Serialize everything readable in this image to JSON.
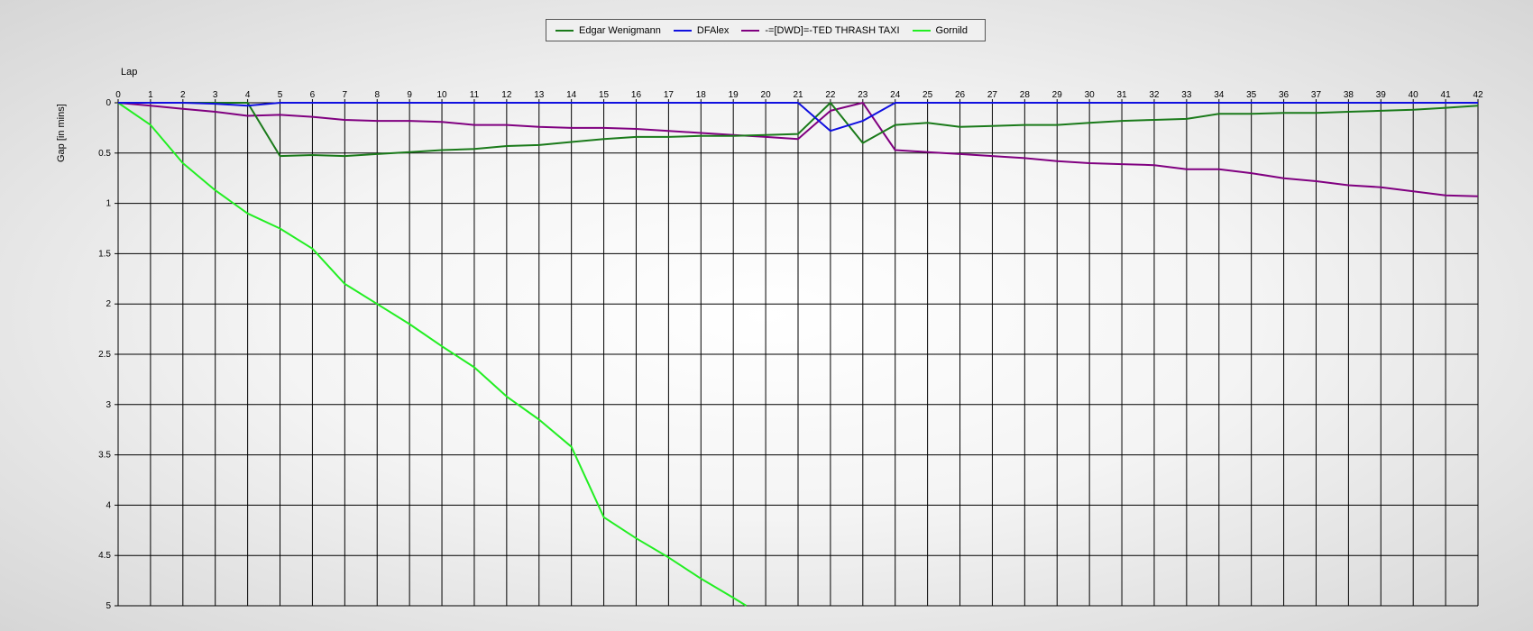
{
  "legend": [
    {
      "name": "Edgar Wenigmann",
      "color": "#1a7a1a"
    },
    {
      "name": "DFAlex",
      "color": "#1010e0"
    },
    {
      "name": "-=[DWD]=-TED THRASH TAXI",
      "color": "#800080"
    },
    {
      "name": "Gornild",
      "color": "#22ee22"
    }
  ],
  "chart_data": {
    "type": "line",
    "title": "",
    "xlabel": "Lap",
    "ylabel": "Gap [in mins]",
    "xlim": [
      0,
      42
    ],
    "ylim": [
      0,
      5
    ],
    "y_inverted": true,
    "grid": true,
    "legend_position": "top-center",
    "x_ticks": [
      0,
      1,
      2,
      3,
      4,
      5,
      6,
      7,
      8,
      9,
      10,
      11,
      12,
      13,
      14,
      15,
      16,
      17,
      18,
      19,
      20,
      21,
      22,
      23,
      24,
      25,
      26,
      27,
      28,
      29,
      30,
      31,
      32,
      33,
      34,
      35,
      36,
      37,
      38,
      39,
      40,
      41,
      42
    ],
    "y_ticks": [
      "0",
      "0.5",
      "1",
      "1.5",
      "2",
      "2.5",
      "3",
      "3.5",
      "4",
      "4.5",
      "5"
    ],
    "series": [
      {
        "name": "Edgar Wenigmann",
        "color": "#1a7a1a",
        "x": [
          0,
          1,
          2,
          3,
          4,
          5,
          6,
          7,
          8,
          9,
          10,
          11,
          12,
          13,
          14,
          15,
          16,
          17,
          18,
          19,
          20,
          21,
          22,
          23,
          24,
          25,
          26,
          27,
          28,
          29,
          30,
          31,
          32,
          33,
          34,
          35,
          36,
          37,
          38,
          39,
          40,
          41,
          42
        ],
        "y": [
          0,
          0,
          0,
          0,
          0,
          0.53,
          0.52,
          0.53,
          0.51,
          0.49,
          0.47,
          0.46,
          0.43,
          0.42,
          0.39,
          0.36,
          0.34,
          0.34,
          0.33,
          0.33,
          0.32,
          0.31,
          0,
          0.4,
          0.22,
          0.2,
          0.24,
          0.23,
          0.22,
          0.22,
          0.2,
          0.18,
          0.17,
          0.16,
          0.11,
          0.11,
          0.1,
          0.1,
          0.09,
          0.08,
          0.07,
          0.05,
          0.03
        ]
      },
      {
        "name": "DFAlex",
        "color": "#1010e0",
        "x": [
          0,
          1,
          2,
          3,
          4,
          5,
          6,
          7,
          8,
          9,
          10,
          11,
          12,
          13,
          14,
          15,
          16,
          17,
          18,
          19,
          20,
          21,
          22,
          23,
          24,
          25,
          26,
          27,
          28,
          29,
          30,
          31,
          32,
          33,
          34,
          35,
          36,
          37,
          38,
          39,
          40,
          41,
          42
        ],
        "y": [
          0,
          0,
          0,
          0.01,
          0.03,
          0,
          0,
          0,
          0,
          0,
          0,
          0,
          0,
          0,
          0,
          0,
          0,
          0,
          0,
          0,
          0,
          0,
          0.28,
          0.18,
          0,
          0,
          0,
          0,
          0,
          0,
          0,
          0,
          0,
          0,
          0,
          0,
          0,
          0,
          0,
          0,
          0,
          0,
          0
        ]
      },
      {
        "name": "-=[DWD]=-TED THRASH TAXI",
        "color": "#800080",
        "x": [
          0,
          1,
          2,
          3,
          4,
          5,
          6,
          7,
          8,
          9,
          10,
          11,
          12,
          13,
          14,
          15,
          16,
          17,
          18,
          19,
          20,
          21,
          22,
          23,
          24,
          25,
          26,
          27,
          28,
          29,
          30,
          31,
          32,
          33,
          34,
          35,
          36,
          37,
          38,
          39,
          40,
          41,
          42
        ],
        "y": [
          0,
          0.03,
          0.06,
          0.09,
          0.13,
          0.12,
          0.14,
          0.17,
          0.18,
          0.18,
          0.19,
          0.22,
          0.22,
          0.24,
          0.25,
          0.25,
          0.26,
          0.28,
          0.3,
          0.32,
          0.34,
          0.36,
          0.08,
          0,
          0.47,
          0.49,
          0.51,
          0.53,
          0.55,
          0.58,
          0.6,
          0.61,
          0.62,
          0.66,
          0.66,
          0.7,
          0.75,
          0.78,
          0.82,
          0.84,
          0.88,
          0.92,
          0.93
        ]
      },
      {
        "name": "Gornild",
        "color": "#22ee22",
        "x": [
          0,
          1,
          2,
          3,
          4,
          5,
          6,
          7,
          8,
          9,
          10,
          11,
          12,
          13,
          14,
          15,
          16,
          17,
          18,
          19,
          19.4
        ],
        "y": [
          0,
          0.22,
          0.6,
          0.87,
          1.1,
          1.25,
          1.45,
          1.8,
          2.0,
          2.2,
          2.42,
          2.63,
          2.92,
          3.15,
          3.42,
          4.12,
          4.33,
          4.52,
          4.73,
          4.92,
          5.0
        ]
      }
    ]
  }
}
